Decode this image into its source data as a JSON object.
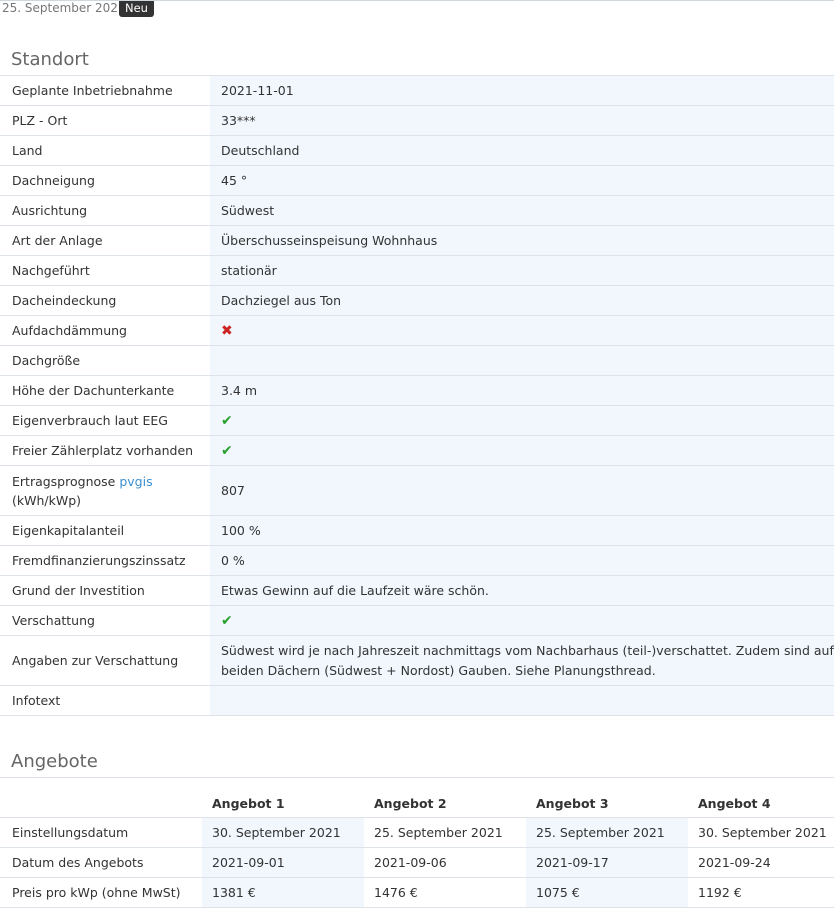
{
  "header": {
    "date": "25. September 2021",
    "badge": "Neu"
  },
  "standort": {
    "title": "Standort",
    "rows": [
      {
        "label": "Geplante Inbetriebnahme",
        "value": "2021-11-01"
      },
      {
        "label": "PLZ - Ort",
        "value": "33***"
      },
      {
        "label": "Land",
        "value": "Deutschland"
      },
      {
        "label": "Dachneigung",
        "value": "45 °"
      },
      {
        "label": "Ausrichtung",
        "value": "Südwest"
      },
      {
        "label": "Art der Anlage",
        "value": "Überschusseinspeisung Wohnhaus"
      },
      {
        "label": "Nachgeführt",
        "value": "stationär"
      },
      {
        "label": "Dacheindeckung",
        "value": "Dachziegel aus Ton"
      },
      {
        "label": "Aufdachdämmung",
        "icon": "cross-icon"
      },
      {
        "label": "Dachgröße",
        "value": ""
      },
      {
        "label": "Höhe der Dachunterkante",
        "value": "3.4 m"
      },
      {
        "label": "Eigenverbrauch laut EEG",
        "icon": "check-icon"
      },
      {
        "label": "Freier Zählerplatz vorhanden",
        "icon": "check-icon"
      },
      {
        "label": "Ertragsprognose",
        "label_link": "pvgis",
        "label_suffix": "(kWh/kWp)",
        "value": "807"
      },
      {
        "label": "Eigenkapitalanteil",
        "value": "100 %"
      },
      {
        "label": "Fremdfinanzierungszinssatz",
        "value": "0 %"
      },
      {
        "label": "Grund der Investition",
        "value": "Etwas Gewinn auf die Laufzeit wäre schön."
      },
      {
        "label": "Verschattung",
        "icon": "check-icon"
      },
      {
        "label": "Angaben zur Verschattung",
        "value_line1": "Südwest wird je nach Jahreszeit nachmittags vom Nachbarhaus (teil-)verschattet. Zudem sind auf",
        "value_line2": "beiden Dächern (Südwest + Nordost) Gauben. Siehe Planungsthread."
      },
      {
        "label": "Infotext",
        "value": ""
      }
    ],
    "icons": {
      "check": "✔",
      "cross": "✖"
    },
    "colors": {
      "check": "#27a02d",
      "cross": "#cc2222",
      "value_bg": "#f1f7fd"
    }
  },
  "angebote": {
    "title": "Angebote",
    "columns": [
      "Angebot 1",
      "Angebot 2",
      "Angebot 3",
      "Angebot 4"
    ],
    "rows": [
      {
        "label": "Einstellungsdatum",
        "cells": [
          "30. September 2021",
          "25. September 2021",
          "25. September 2021",
          "30. September 2021"
        ]
      },
      {
        "label": "Datum des Angebots",
        "cells": [
          "2021-09-01",
          "2021-09-06",
          "2021-09-17",
          "2021-09-24"
        ]
      },
      {
        "label": "Preis pro kWp (ohne MwSt)",
        "cells": [
          "1381 €",
          "1476 €",
          "1075 €",
          "1192 €"
        ]
      }
    ]
  }
}
